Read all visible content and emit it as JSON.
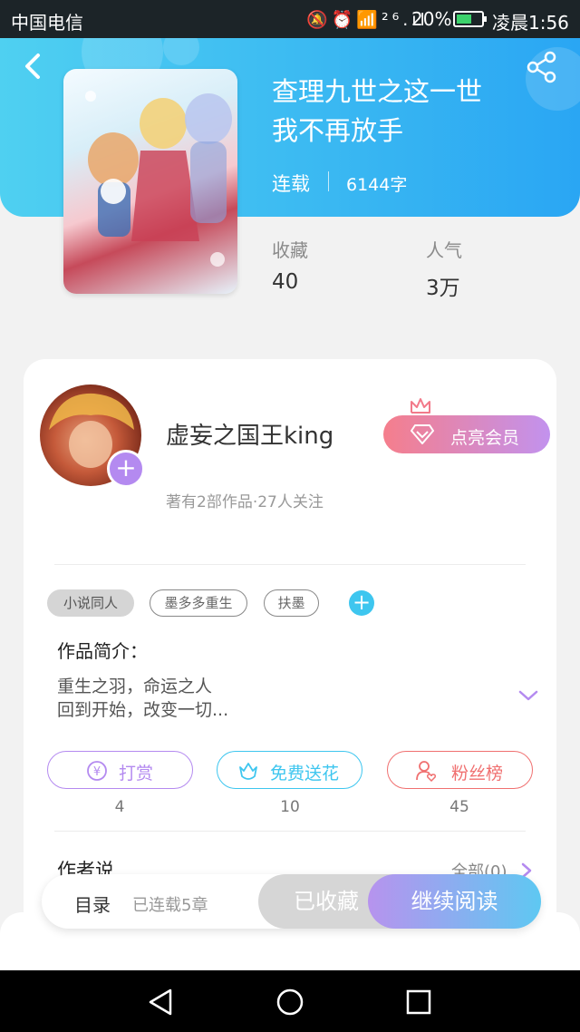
{
  "status_bar": {
    "carrier": "中国电信",
    "icons": "🔕⏰📶²⁶.ıl",
    "battery": "20%",
    "time": "凌晨1:56"
  },
  "book": {
    "title_line1": "查理九世之这一世",
    "title_line2": "我不再放手",
    "status": "连载",
    "word_count": "6144字",
    "favorites_label": "收藏",
    "favorites_value": "40",
    "popularity_label": "人气",
    "popularity_value": "3万"
  },
  "author": {
    "name": "虚妄之国王king",
    "meta": "著有2部作品·27人关注",
    "vip_button": "点亮会员"
  },
  "tags": [
    "小说同人",
    "墨多多重生",
    "扶墨"
  ],
  "intro": {
    "title": "作品简介：",
    "line1": "重生之羽，命运之人",
    "line2": "回到开始，改变一切..."
  },
  "actions": [
    {
      "label": "打赏",
      "count": "4"
    },
    {
      "label": "免费送花",
      "count": "10"
    },
    {
      "label": "粉丝榜",
      "count": "45"
    }
  ],
  "author_says": {
    "title": "作者说",
    "all_link": "全部(0)"
  },
  "bottom_bar": {
    "toc": "目录",
    "serial_info": "已连载5章",
    "collected": "已收藏",
    "continue_reading": "继续阅读"
  },
  "colors": {
    "header_start": "#4fd0f1",
    "header_end": "#2aa6f3",
    "vip_start": "#f57e8c",
    "vip_end": "#c292ee",
    "tip": "#b48af0",
    "flower": "#3ec6ef",
    "fans": "#f07070"
  }
}
